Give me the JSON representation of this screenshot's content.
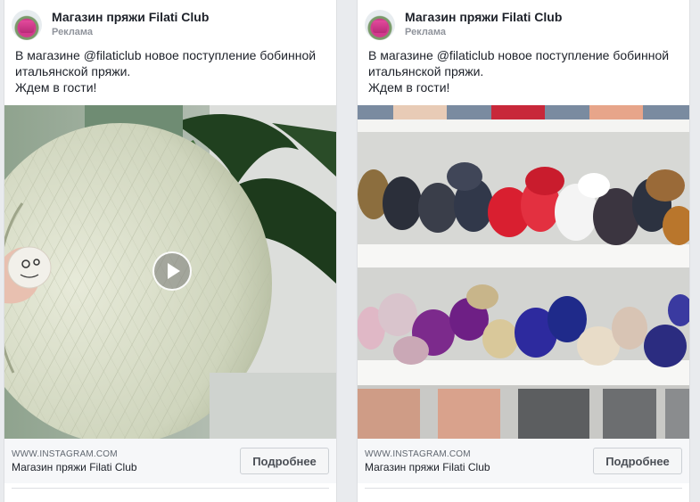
{
  "ads": [
    {
      "page_name": "Магазин пряжи Filati Club",
      "sponsored": "Реклама",
      "text_line1": "В магазине @filaticlub новое поступление бобинной",
      "text_line2": "итальянской пряжи.",
      "text_line3": "Ждем в гости!",
      "link_domain": "WWW.INSTAGRAM.COM",
      "link_title": "Магазин пряжи Filati Club",
      "cta_label": "Подробнее"
    },
    {
      "page_name": "Магазин пряжи Filati Club",
      "sponsored": "Реклама",
      "text_line1": "В магазине @filaticlub новое поступление бобинной",
      "text_line2": "итальянской пряжи.",
      "text_line3": "Ждем в гости!",
      "link_domain": "WWW.INSTAGRAM.COM",
      "link_title": "Магазин пряжи Filati Club",
      "cta_label": "Подробнее"
    }
  ],
  "colors": {
    "page_bg": "#e9ebee",
    "text": "#1d2129",
    "meta": "#90949c",
    "footer_bg": "#f6f7f9"
  },
  "icons": {
    "play": "play-icon"
  }
}
